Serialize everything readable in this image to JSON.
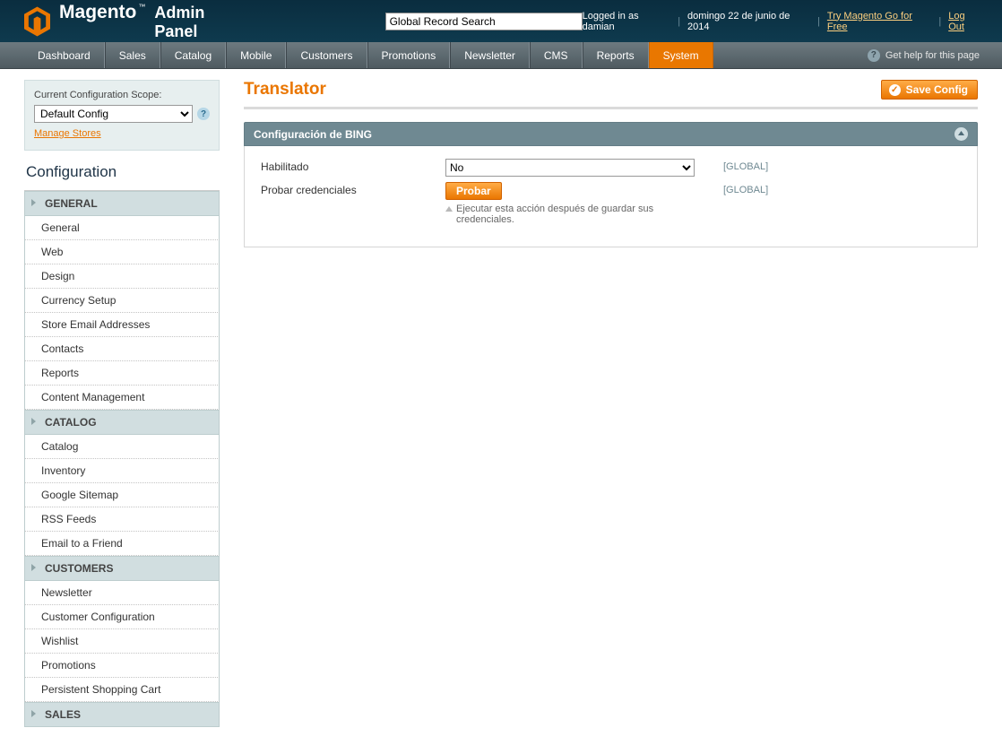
{
  "header": {
    "logo_main": "Magento",
    "logo_sub": "Admin Panel",
    "search_placeholder": "Global Record Search",
    "logged_in_as": "Logged in as damian",
    "date": "domingo 22 de junio de 2014",
    "try_link": "Try Magento Go for Free",
    "logout": "Log Out"
  },
  "nav": {
    "items": [
      "Dashboard",
      "Sales",
      "Catalog",
      "Mobile",
      "Customers",
      "Promotions",
      "Newsletter",
      "CMS",
      "Reports",
      "System"
    ],
    "active_index": 9,
    "help": "Get help for this page"
  },
  "scope": {
    "label": "Current Configuration Scope:",
    "value": "Default Config",
    "manage": "Manage Stores"
  },
  "config_title": "Configuration",
  "sidebar": {
    "sections": [
      {
        "title": "GENERAL",
        "items": [
          "General",
          "Web",
          "Design",
          "Currency Setup",
          "Store Email Addresses",
          "Contacts",
          "Reports",
          "Content Management"
        ]
      },
      {
        "title": "CATALOG",
        "items": [
          "Catalog",
          "Inventory",
          "Google Sitemap",
          "RSS Feeds",
          "Email to a Friend"
        ]
      },
      {
        "title": "CUSTOMERS",
        "items": [
          "Newsletter",
          "Customer Configuration",
          "Wishlist",
          "Promotions",
          "Persistent Shopping Cart"
        ]
      },
      {
        "title": "SALES",
        "items": []
      }
    ]
  },
  "page": {
    "title": "Translator",
    "save_button": "Save Config",
    "fieldset_title": "Configuración de BING",
    "rows": {
      "enabled": {
        "label": "Habilitado",
        "value": "No",
        "scope": "[GLOBAL]"
      },
      "test": {
        "label": "Probar credenciales",
        "button": "Probar",
        "scope": "[GLOBAL]",
        "hint": "Ejecutar esta acción después de guardar sus credenciales."
      }
    }
  }
}
